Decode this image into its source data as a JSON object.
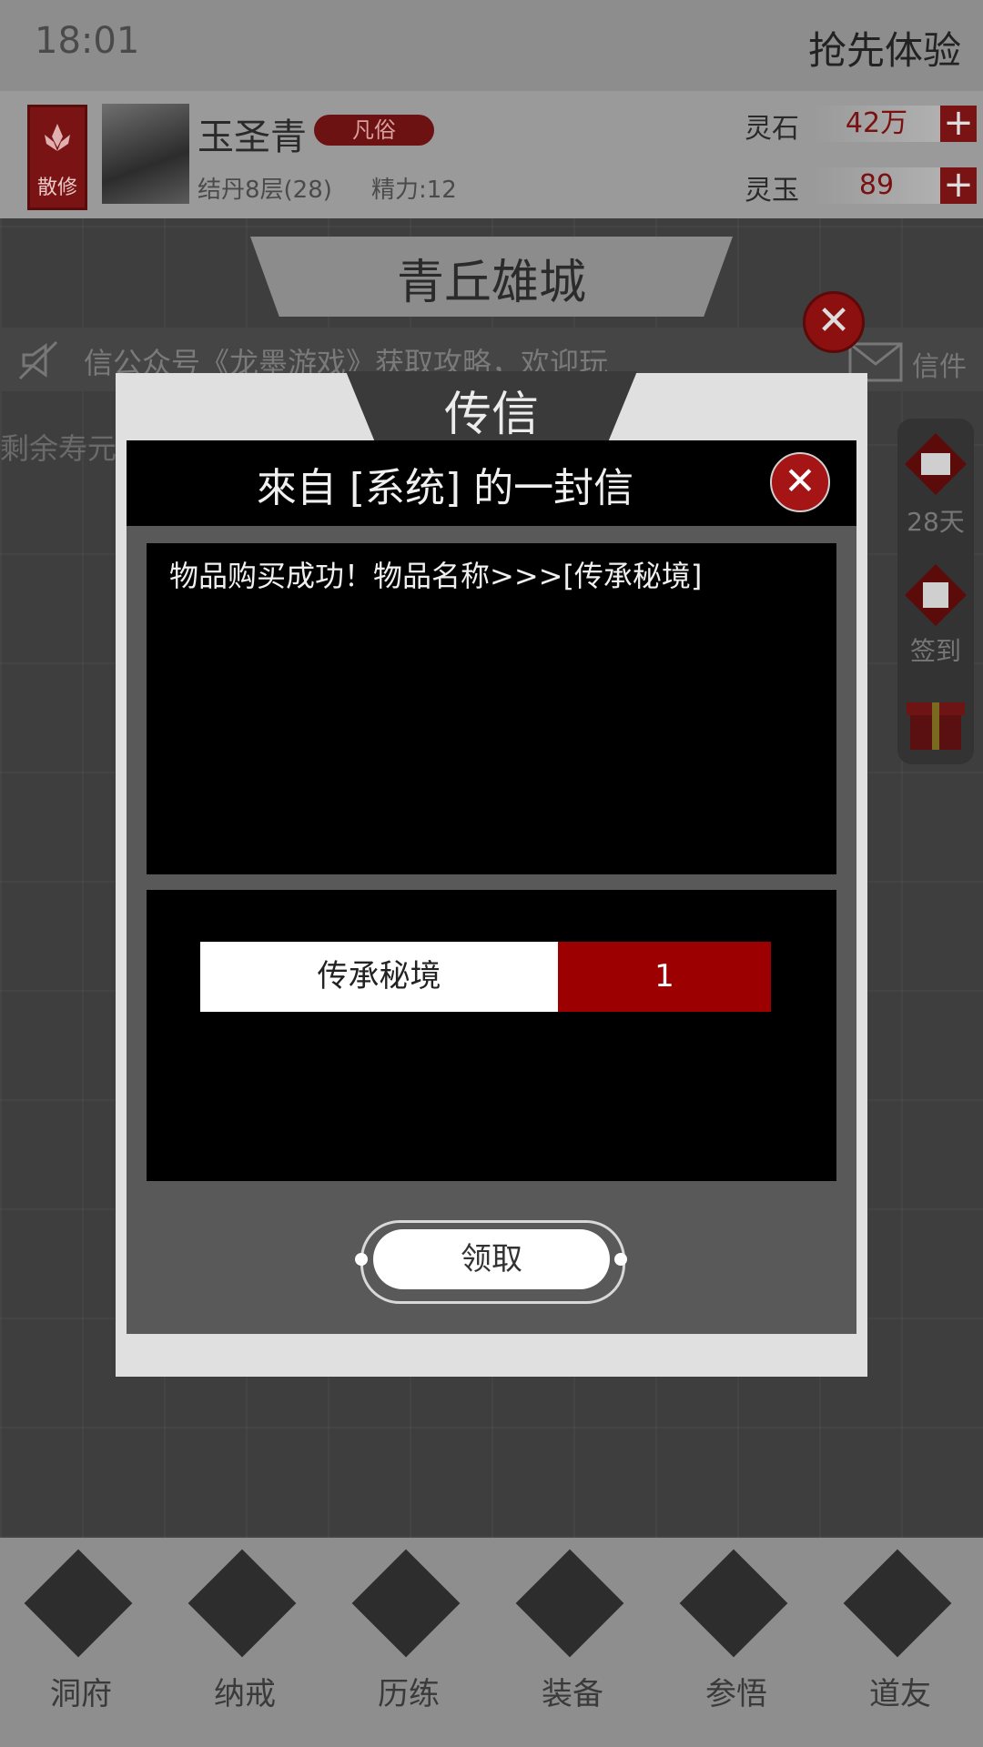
{
  "status": {
    "time": "18:01",
    "early_access": "抢先体验"
  },
  "player": {
    "sect": "散修",
    "name": "玉圣青",
    "rank": "凡俗",
    "level": "结丹8层(28)",
    "energy": "精力:12"
  },
  "currency": [
    {
      "label": "灵石",
      "value": "42万",
      "plus": "+"
    },
    {
      "label": "灵玉",
      "value": "89",
      "plus": "+"
    }
  ],
  "location": {
    "title": "青丘雄城"
  },
  "notice": {
    "text": "信公众号《龙墨游戏》获取攻略，欢迎玩",
    "mail_label": "信件"
  },
  "lifespan": {
    "text": "剩余寿元"
  },
  "side": [
    {
      "icon": "token-icon",
      "label": "28天"
    },
    {
      "icon": "checkin-icon",
      "label": "签到"
    },
    {
      "icon": "gift-icon",
      "label": ""
    }
  ],
  "dialog": {
    "title": "传信",
    "header": "來自 [系统] 的一封信",
    "close": "✕",
    "message": "物品购买成功！物品名称>>>[传承秘境]",
    "items": [
      {
        "name": "传承秘境",
        "qty": "1"
      }
    ],
    "claim": "领取"
  },
  "nav": [
    {
      "label": "洞府",
      "icon": "gate-icon"
    },
    {
      "label": "纳戒",
      "icon": "ring-icon"
    },
    {
      "label": "历练",
      "icon": "crossed-swords-icon"
    },
    {
      "label": "装备",
      "icon": "dagger-icon"
    },
    {
      "label": "参悟",
      "icon": "book-icon"
    },
    {
      "label": "道友",
      "icon": "handshake-icon"
    }
  ],
  "colors": {
    "accent_red": "#9c0000",
    "overlay_dark": "#3c3c3c"
  }
}
